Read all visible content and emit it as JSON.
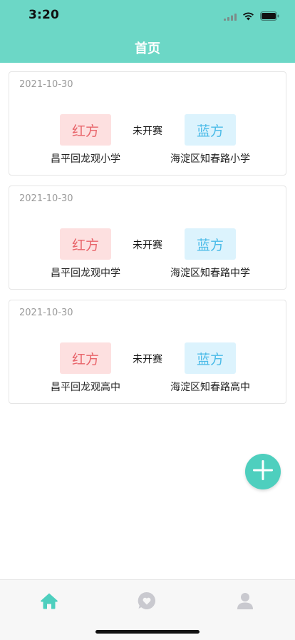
{
  "status_bar": {
    "time": "3:20"
  },
  "header": {
    "title": "首页"
  },
  "matches": [
    {
      "date": "2021-10-30",
      "red_label": "红方",
      "blue_label": "蓝方",
      "status": "未开赛",
      "red_school": "昌平回龙观小学",
      "blue_school": "海淀区知春路小学"
    },
    {
      "date": "2021-10-30",
      "red_label": "红方",
      "blue_label": "蓝方",
      "status": "未开赛",
      "red_school": "昌平回龙观中学",
      "blue_school": "海淀区知春路中学"
    },
    {
      "date": "2021-10-30",
      "red_label": "红方",
      "blue_label": "蓝方",
      "status": "未开赛",
      "red_school": "昌平回龙观高中",
      "blue_school": "海淀区知春路高中"
    }
  ],
  "fab": {
    "icon": "plus-icon"
  },
  "tabbar": {
    "items": [
      {
        "icon": "home-icon",
        "active": true
      },
      {
        "icon": "chat-icon",
        "active": false
      },
      {
        "icon": "user-icon",
        "active": false
      }
    ]
  },
  "colors": {
    "brand": "#6cd7c6",
    "accent": "#4ecfbe",
    "red_team": "#e8646a",
    "blue_team": "#4bbbe8",
    "tab_inactive": "#c9c9cf"
  }
}
